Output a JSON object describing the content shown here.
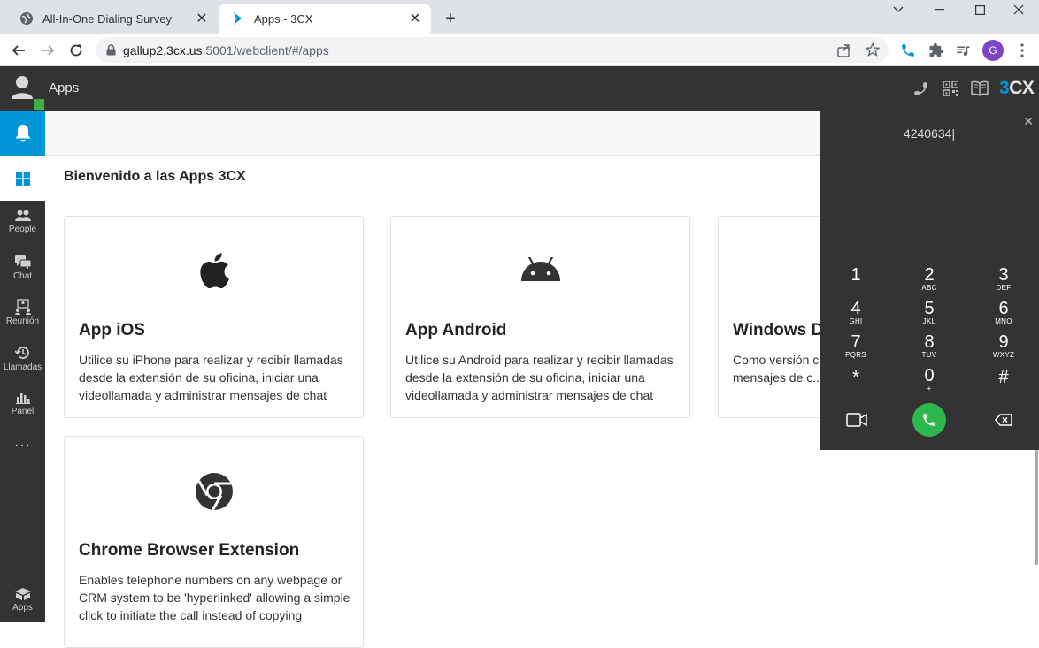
{
  "browser": {
    "tabs": [
      {
        "title": "All-In-One Dialing Survey",
        "active": false
      },
      {
        "title": "Apps - 3CX",
        "active": true
      }
    ],
    "url_host": "gallup2.3cx.us",
    "url_rest": ":5001/webclient/#/apps",
    "profile_initial": "G"
  },
  "header": {
    "title": "Apps",
    "brand": "3CX"
  },
  "sidebar": {
    "items": [
      {
        "label": "People"
      },
      {
        "label": "Chat"
      },
      {
        "label": "Reunión"
      },
      {
        "label": "Llamadas"
      },
      {
        "label": "Panel"
      },
      {
        "label": "Apps"
      }
    ],
    "more": "···"
  },
  "main": {
    "welcome": "Bienvenido a las Apps 3CX",
    "cards": [
      {
        "title": "App iOS",
        "desc": "Utilice su iPhone para realizar y recibir llamadas desde la extensión de su oficina, iniciar una videollamada y administrar mensajes de chat",
        "icon": "apple-icon"
      },
      {
        "title": "App Android",
        "desc": "Utilice su Android para realizar y recibir llamadas desde la extensión de su oficina, iniciar una videollamada y administrar mensajes de chat",
        "icon": "android-icon"
      },
      {
        "title": "Windows Desktop",
        "desc": "Como versión c... Windows Deskto... y mensajes de c...",
        "icon": "windows-icon"
      },
      {
        "title": "Chrome Browser Extension",
        "desc": "Enables telephone numbers on any webpage or CRM system to be 'hyperlinked' allowing a simple click to initiate the call instead of copying",
        "icon": "chrome-icon"
      }
    ]
  },
  "dialer": {
    "number": "4240634",
    "keys": [
      {
        "digit": "1",
        "letters": ""
      },
      {
        "digit": "2",
        "letters": "ABC"
      },
      {
        "digit": "3",
        "letters": "DEF"
      },
      {
        "digit": "4",
        "letters": "GHI"
      },
      {
        "digit": "5",
        "letters": "JKL"
      },
      {
        "digit": "6",
        "letters": "MNO"
      },
      {
        "digit": "7",
        "letters": "PQRS"
      },
      {
        "digit": "8",
        "letters": "TUV"
      },
      {
        "digit": "9",
        "letters": "WXYZ"
      },
      {
        "digit": "*",
        "letters": ""
      },
      {
        "digit": "0",
        "letters": "+"
      },
      {
        "digit": "#",
        "letters": ""
      }
    ]
  },
  "colors": {
    "accent": "#0096d6",
    "call_green": "#2db84d",
    "dark_bg": "#333333",
    "presence_green": "#3cb043"
  }
}
